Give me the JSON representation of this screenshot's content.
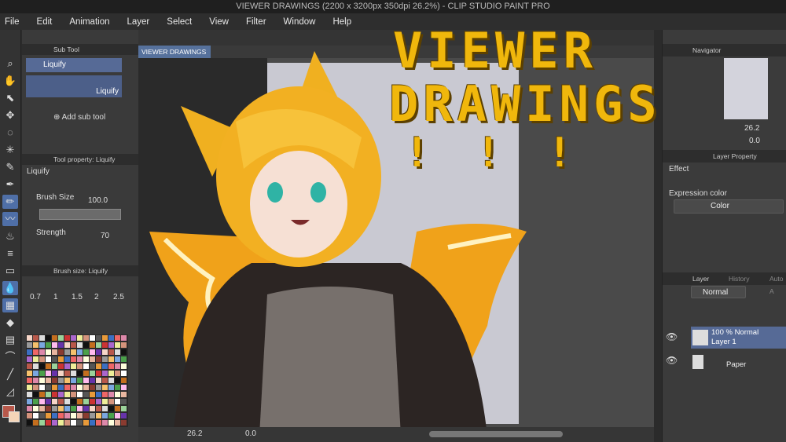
{
  "window_title": "VIEWER DRAWINGS (2200 x 3200px 350dpi 26.2%) - CLIP STUDIO PAINT PRO",
  "menu": [
    "File",
    "Edit",
    "Animation",
    "Layer",
    "Select",
    "View",
    "Filter",
    "Window",
    "Help"
  ],
  "subtool": {
    "header": "Sub Tool",
    "item1": "Liquify",
    "item2": "Liquify",
    "add": "Add sub tool"
  },
  "tool_property": {
    "header": "Tool property: Liquify",
    "title": "Liquify",
    "brush_size_label": "Brush Size",
    "brush_size_value": "100.0",
    "strength_label": "Strength",
    "strength_value": "70"
  },
  "brush_size_panel": {
    "header": "Brush size: Liquify",
    "sizes": [
      "0.7",
      "1",
      "1.5",
      "2",
      "2.5"
    ]
  },
  "document_tab": "VIEWER DRAWINGS",
  "status": {
    "zoom": "26.2",
    "angle": "0.0"
  },
  "overlay": {
    "line1": "VIEWER",
    "line2": "DRAWINGS",
    "line3": "! ! !"
  },
  "navigator": {
    "header": "Navigator",
    "zoom": "26.2",
    "angle": "0.0"
  },
  "layer_property": {
    "header": "Layer Property",
    "effect_label": "Effect",
    "expression_label": "Expression color",
    "expression_value": "Color"
  },
  "layer_panel": {
    "tabs": [
      "Layer",
      "History",
      "Auto A"
    ],
    "blend_mode": "Normal",
    "layers": [
      {
        "line1": "100 % Normal",
        "line2": "Layer 1"
      },
      {
        "line1": "",
        "line2": "Paper"
      }
    ]
  },
  "colors": {
    "accent": "#566a96",
    "title_yellow": "#f0b70c",
    "main_color": "#b8584a"
  }
}
